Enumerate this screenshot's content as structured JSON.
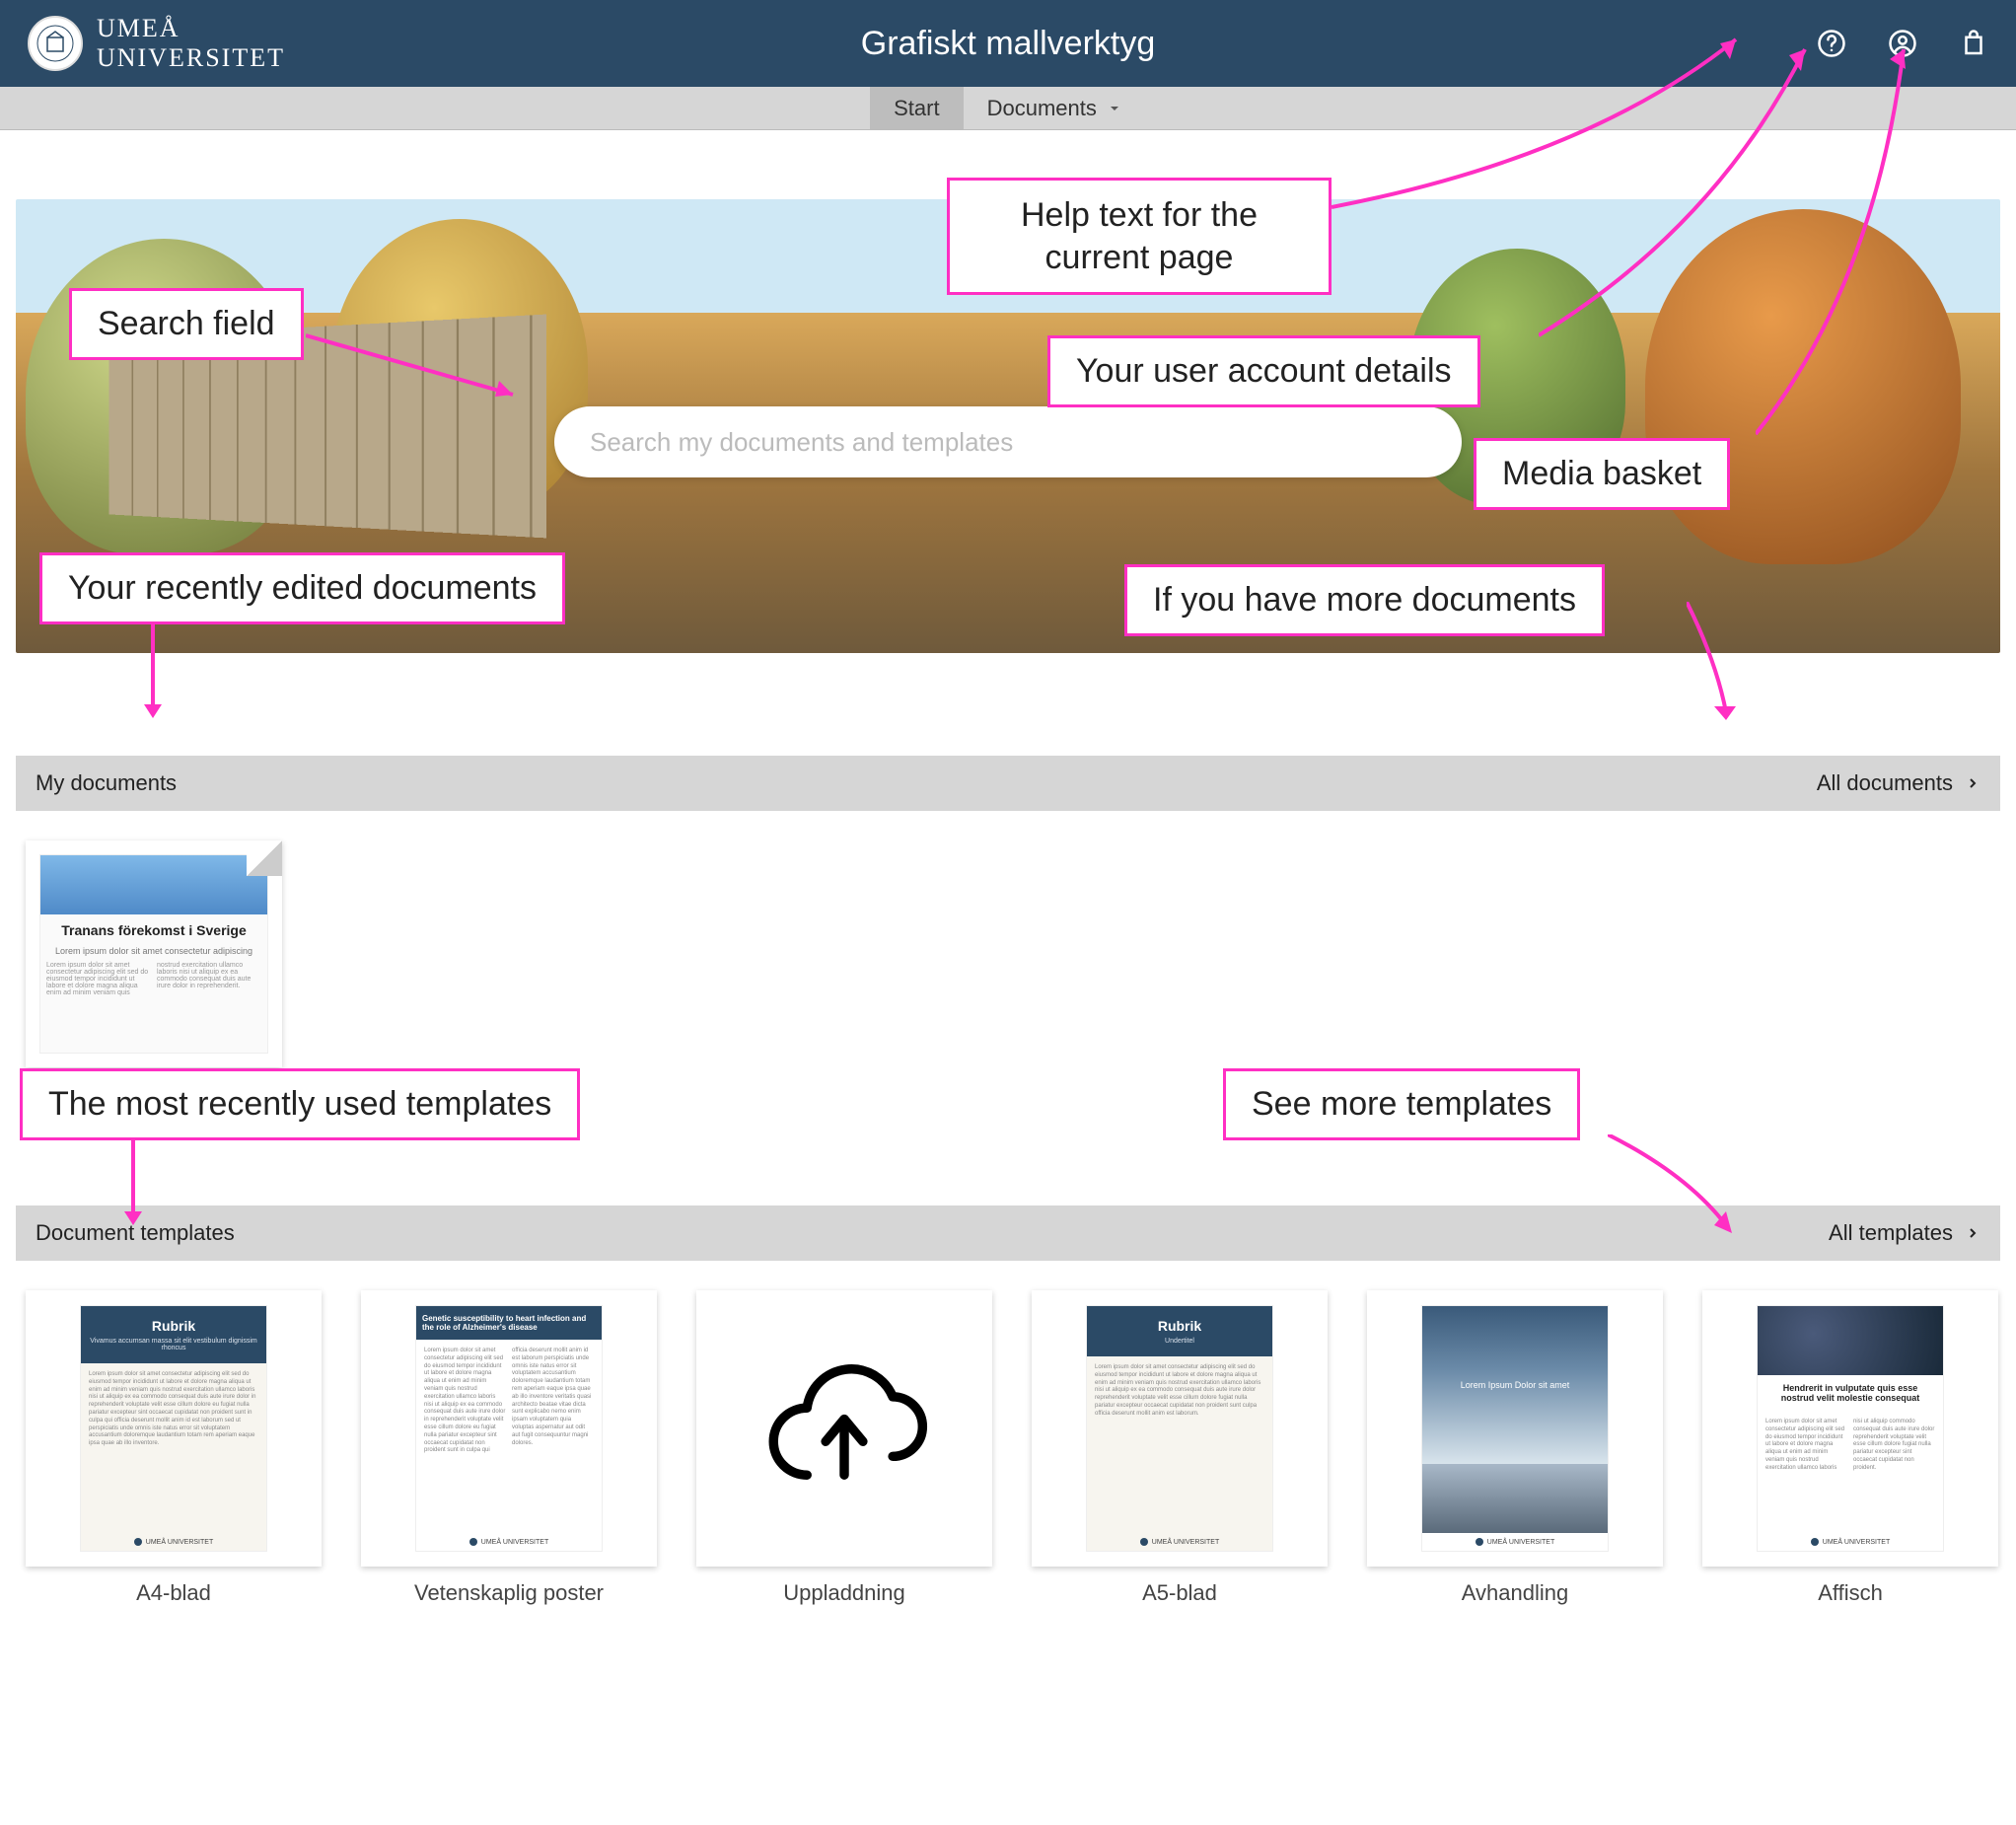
{
  "header": {
    "brand_line1": "UMEÅ",
    "brand_line2": "UNIVERSITET",
    "app_title": "Grafiskt mallverktyg"
  },
  "nav": {
    "start": "Start",
    "documents": "Documents"
  },
  "search": {
    "placeholder": "Search my documents and templates"
  },
  "sections": {
    "my_docs_title": "My documents",
    "my_docs_all": "All documents",
    "templates_title": "Document templates",
    "templates_all": "All templates"
  },
  "my_documents": [
    {
      "title": "Tranans förekomst i Sverige",
      "subtitle": "Lorem ipsum dolor sit amet consectetur adipiscing"
    }
  ],
  "templates": [
    {
      "label": "A4-blad",
      "heading": "Rubrik"
    },
    {
      "label": "Vetenskaplig poster",
      "heading": "Genetic susceptibility to heart infection and the role of Alzheimer's disease"
    },
    {
      "label": "Uppladdning",
      "heading": ""
    },
    {
      "label": "A5-blad",
      "heading": "Rubrik"
    },
    {
      "label": "Avhandling",
      "heading": "Lorem Ipsum Dolor sit amet"
    },
    {
      "label": "Affisch",
      "heading": "Hendrerit in vulputate quis esse nostrud velit molestie consequat"
    }
  ],
  "callouts": {
    "search_field": "Search field",
    "help_text": "Help text for the current page",
    "account": "Your user account details",
    "basket": "Media basket",
    "recent_docs": "Your recently edited documents",
    "more_docs": "If you have more documents",
    "recent_templates": "The most recently used templates",
    "more_templates": "See more templates"
  }
}
